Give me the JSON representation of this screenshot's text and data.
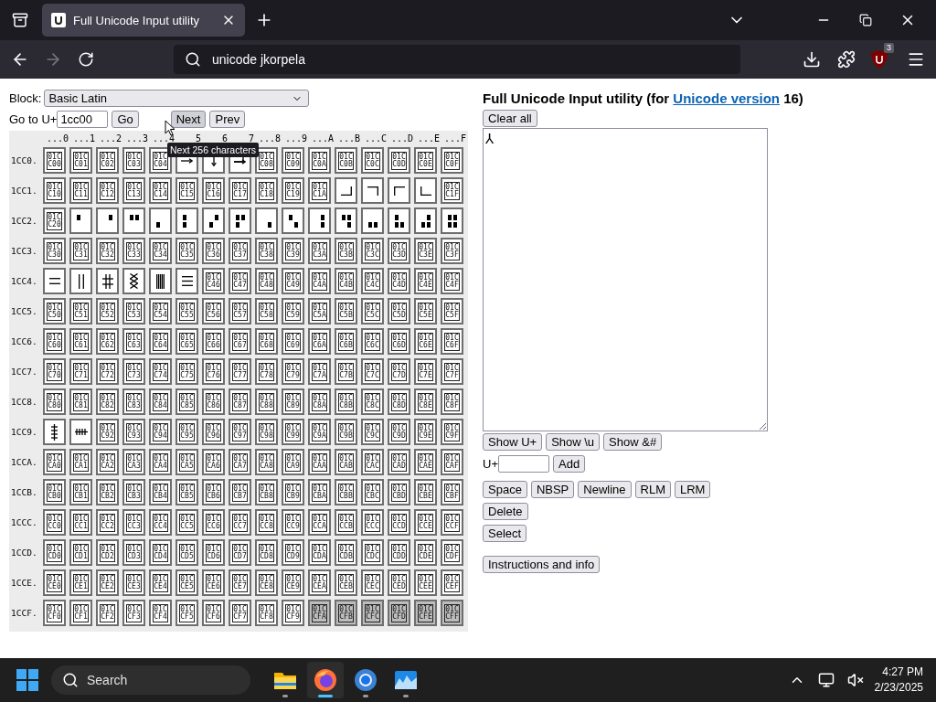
{
  "browser": {
    "tabs": [
      {
        "title": "Full Unicode Input utility",
        "selected": true
      }
    ],
    "back_disabled": false,
    "forward_disabled": true,
    "address": "unicode jkorpela",
    "extension_badge": "3"
  },
  "chooser": {
    "block_label": "Block:",
    "block_value": "Basic Latin",
    "goto_label": "Go to U+",
    "goto_value": "1cc00",
    "buttons": [
      {
        "label": "Go",
        "hovered": false
      },
      {
        "label": "Next",
        "hovered": true
      },
      {
        "label": "Prev",
        "hovered": false
      }
    ],
    "tooltip": "Next 256 characters",
    "columns": [
      "...0",
      "...1",
      "...2",
      "...3",
      "...4",
      "5",
      "6",
      "7",
      "...8",
      "...9",
      "...A",
      "...B",
      "...C",
      "...D",
      "...E",
      "...F"
    ],
    "rows": [
      {
        "label": "1CC0.",
        "cells": [
          {
            "kind": "missing",
            "glyph": "01CC00",
            "disabled": false
          },
          {
            "kind": "missing",
            "glyph": "01CC01",
            "disabled": false
          },
          {
            "kind": "missing",
            "glyph": "01CC02",
            "disabled": false
          },
          {
            "kind": "missing",
            "glyph": "01CC03",
            "disabled": false
          },
          {
            "kind": "missing",
            "glyph": "01CC04",
            "disabled": false
          },
          {
            "kind": "rightarrow",
            "disabled": false
          },
          {
            "kind": "downarrow",
            "disabled": false
          },
          {
            "kind": "hookarrow",
            "disabled": false
          },
          {
            "kind": "missing",
            "glyph": "01CC08",
            "disabled": false
          },
          {
            "kind": "missing",
            "glyph": "01CC09",
            "disabled": false
          },
          {
            "kind": "missing",
            "glyph": "01CC0A",
            "disabled": false
          },
          {
            "kind": "missing",
            "glyph": "01CC0B",
            "disabled": false
          },
          {
            "kind": "missing",
            "glyph": "01CC0C",
            "disabled": false
          },
          {
            "kind": "missing",
            "glyph": "01CC0D",
            "disabled": false
          },
          {
            "kind": "missing",
            "glyph": "01CC0E",
            "disabled": false
          },
          {
            "kind": "missing",
            "glyph": "01CC0F",
            "disabled": false
          }
        ]
      },
      {
        "label": "1CC1.",
        "cells": [
          {
            "kind": "missing",
            "glyph": "01CC10",
            "disabled": false
          },
          {
            "kind": "missing",
            "glyph": "01CC11",
            "disabled": false
          },
          {
            "kind": "missing",
            "glyph": "01CC12",
            "disabled": false
          },
          {
            "kind": "missing",
            "glyph": "01CC13",
            "disabled": false
          },
          {
            "kind": "missing",
            "glyph": "01CC14",
            "disabled": false
          },
          {
            "kind": "missing",
            "glyph": "01CC15",
            "disabled": false
          },
          {
            "kind": "missing",
            "glyph": "01CC16",
            "disabled": false
          },
          {
            "kind": "missing",
            "glyph": "01CC17",
            "disabled": false
          },
          {
            "kind": "missing",
            "glyph": "01CC18",
            "disabled": false
          },
          {
            "kind": "missing",
            "glyph": "01CC19",
            "disabled": false
          },
          {
            "kind": "missing",
            "glyph": "01CC1A",
            "disabled": false
          },
          {
            "kind": "cornerbr",
            "disabled": false
          },
          {
            "kind": "cornertr",
            "disabled": false
          },
          {
            "kind": "cornertl",
            "disabled": false
          },
          {
            "kind": "cornerbl",
            "disabled": false
          },
          {
            "kind": "missing",
            "glyph": "01CC1F",
            "disabled": false
          }
        ]
      },
      {
        "label": "1CC2.",
        "cells": [
          {
            "kind": "missing",
            "glyph": "01CC20",
            "disabled": false
          },
          {
            "kind": "quad1000",
            "disabled": false
          },
          {
            "kind": "quad0100",
            "disabled": false
          },
          {
            "kind": "quad1100",
            "disabled": false
          },
          {
            "kind": "quad0010",
            "disabled": false
          },
          {
            "kind": "quad1010",
            "disabled": false
          },
          {
            "kind": "quad0110",
            "disabled": false
          },
          {
            "kind": "quad1110",
            "disabled": false
          },
          {
            "kind": "quad0001",
            "disabled": false
          },
          {
            "kind": "quad1001",
            "disabled": false
          },
          {
            "kind": "quad0101",
            "disabled": false
          },
          {
            "kind": "quad1101",
            "disabled": false
          },
          {
            "kind": "quad0011",
            "disabled": false
          },
          {
            "kind": "quad1011",
            "disabled": false
          },
          {
            "kind": "quad0111",
            "disabled": false
          },
          {
            "kind": "quad1111",
            "disabled": false
          }
        ]
      },
      {
        "label": "1CC3.",
        "cells": [
          {
            "kind": "missing",
            "glyph": "01CC30",
            "disabled": false
          },
          {
            "kind": "missing",
            "glyph": "01CC31",
            "disabled": false
          },
          {
            "kind": "missing",
            "glyph": "01CC32",
            "disabled": false
          },
          {
            "kind": "missing",
            "glyph": "01CC33",
            "disabled": false
          },
          {
            "kind": "missing",
            "glyph": "01CC34",
            "disabled": false
          },
          {
            "kind": "missing",
            "glyph": "01CC35",
            "disabled": false
          },
          {
            "kind": "missing",
            "glyph": "01CC36",
            "disabled": false
          },
          {
            "kind": "missing",
            "glyph": "01CC37",
            "disabled": false
          },
          {
            "kind": "missing",
            "glyph": "01CC38",
            "disabled": false
          },
          {
            "kind": "missing",
            "glyph": "01CC39",
            "disabled": false
          },
          {
            "kind": "missing",
            "glyph": "01CC3A",
            "disabled": false
          },
          {
            "kind": "missing",
            "glyph": "01CC3B",
            "disabled": false
          },
          {
            "kind": "missing",
            "glyph": "01CC3C",
            "disabled": false
          },
          {
            "kind": "missing",
            "glyph": "01CC3D",
            "disabled": false
          },
          {
            "kind": "missing",
            "glyph": "01CC3E",
            "disabled": false
          },
          {
            "kind": "missing",
            "glyph": "01CC3F",
            "disabled": false
          }
        ]
      },
      {
        "label": "1CC4.",
        "cells": [
          {
            "kind": "doubleline",
            "disabled": false
          },
          {
            "kind": "doublebar",
            "disabled": false
          },
          {
            "kind": "hash",
            "disabled": false
          },
          {
            "kind": "lattice",
            "disabled": false
          },
          {
            "kind": "bars",
            "disabled": false
          },
          {
            "kind": "tripleline",
            "disabled": false
          },
          {
            "kind": "missing",
            "glyph": "01CC46",
            "disabled": false
          },
          {
            "kind": "missing",
            "glyph": "01CC47",
            "disabled": false
          },
          {
            "kind": "missing",
            "glyph": "01CC48",
            "disabled": false
          },
          {
            "kind": "missing",
            "glyph": "01CC49",
            "disabled": false
          },
          {
            "kind": "missing",
            "glyph": "01CC4A",
            "disabled": false
          },
          {
            "kind": "missing",
            "glyph": "01CC4B",
            "disabled": false
          },
          {
            "kind": "missing",
            "glyph": "01CC4C",
            "disabled": false
          },
          {
            "kind": "missing",
            "glyph": "01CC4D",
            "disabled": false
          },
          {
            "kind": "missing",
            "glyph": "01CC4E",
            "disabled": false
          },
          {
            "kind": "missing",
            "glyph": "01CC4F",
            "disabled": false
          }
        ]
      },
      {
        "label": "1CC5.",
        "cells": [
          {
            "kind": "missing",
            "glyph": "01CC50",
            "disabled": false
          },
          {
            "kind": "missing",
            "glyph": "01CC51",
            "disabled": false
          },
          {
            "kind": "missing",
            "glyph": "01CC52",
            "disabled": false
          },
          {
            "kind": "missing",
            "glyph": "01CC53",
            "disabled": false
          },
          {
            "kind": "missing",
            "glyph": "01CC54",
            "disabled": false
          },
          {
            "kind": "missing",
            "glyph": "01CC55",
            "disabled": false
          },
          {
            "kind": "missing",
            "glyph": "01CC56",
            "disabled": false
          },
          {
            "kind": "missing",
            "glyph": "01CC57",
            "disabled": false
          },
          {
            "kind": "missing",
            "glyph": "01CC58",
            "disabled": false
          },
          {
            "kind": "missing",
            "glyph": "01CC59",
            "disabled": false
          },
          {
            "kind": "missing",
            "glyph": "01CC5A",
            "disabled": false
          },
          {
            "kind": "missing",
            "glyph": "01CC5B",
            "disabled": false
          },
          {
            "kind": "missing",
            "glyph": "01CC5C",
            "disabled": false
          },
          {
            "kind": "missing",
            "glyph": "01CC5D",
            "disabled": false
          },
          {
            "kind": "missing",
            "glyph": "01CC5E",
            "disabled": false
          },
          {
            "kind": "missing",
            "glyph": "01CC5F",
            "disabled": false
          }
        ]
      },
      {
        "label": "1CC6.",
        "cells": [
          {
            "kind": "missing",
            "glyph": "01CC60",
            "disabled": false
          },
          {
            "kind": "missing",
            "glyph": "01CC61",
            "disabled": false
          },
          {
            "kind": "missing",
            "glyph": "01CC62",
            "disabled": false
          },
          {
            "kind": "missing",
            "glyph": "01CC63",
            "disabled": false
          },
          {
            "kind": "missing",
            "glyph": "01CC64",
            "disabled": false
          },
          {
            "kind": "missing",
            "glyph": "01CC65",
            "disabled": false
          },
          {
            "kind": "missing",
            "glyph": "01CC66",
            "disabled": false
          },
          {
            "kind": "missing",
            "glyph": "01CC67",
            "disabled": false
          },
          {
            "kind": "missing",
            "glyph": "01CC68",
            "disabled": false
          },
          {
            "kind": "missing",
            "glyph": "01CC69",
            "disabled": false
          },
          {
            "kind": "missing",
            "glyph": "01CC6A",
            "disabled": false
          },
          {
            "kind": "missing",
            "glyph": "01CC6B",
            "disabled": false
          },
          {
            "kind": "missing",
            "glyph": "01CC6C",
            "disabled": false
          },
          {
            "kind": "missing",
            "glyph": "01CC6D",
            "disabled": false
          },
          {
            "kind": "missing",
            "glyph": "01CC6E",
            "disabled": false
          },
          {
            "kind": "missing",
            "glyph": "01CC6F",
            "disabled": false
          }
        ]
      },
      {
        "label": "1CC7.",
        "cells": [
          {
            "kind": "missing",
            "glyph": "01CC70",
            "disabled": false
          },
          {
            "kind": "missing",
            "glyph": "01CC71",
            "disabled": false
          },
          {
            "kind": "missing",
            "glyph": "01CC72",
            "disabled": false
          },
          {
            "kind": "missing",
            "glyph": "01CC73",
            "disabled": false
          },
          {
            "kind": "missing",
            "glyph": "01CC74",
            "disabled": false
          },
          {
            "kind": "missing",
            "glyph": "01CC75",
            "disabled": false
          },
          {
            "kind": "missing",
            "glyph": "01CC76",
            "disabled": false
          },
          {
            "kind": "missing",
            "glyph": "01CC77",
            "disabled": false
          },
          {
            "kind": "missing",
            "glyph": "01CC78",
            "disabled": false
          },
          {
            "kind": "missing",
            "glyph": "01CC79",
            "disabled": false
          },
          {
            "kind": "missing",
            "glyph": "01CC7A",
            "disabled": false
          },
          {
            "kind": "missing",
            "glyph": "01CC7B",
            "disabled": false
          },
          {
            "kind": "missing",
            "glyph": "01CC7C",
            "disabled": false
          },
          {
            "kind": "missing",
            "glyph": "01CC7D",
            "disabled": false
          },
          {
            "kind": "missing",
            "glyph": "01CC7E",
            "disabled": false
          },
          {
            "kind": "missing",
            "glyph": "01CC7F",
            "disabled": false
          }
        ]
      },
      {
        "label": "1CC8.",
        "cells": [
          {
            "kind": "missing",
            "glyph": "01CC80",
            "disabled": false
          },
          {
            "kind": "missing",
            "glyph": "01CC81",
            "disabled": false
          },
          {
            "kind": "missing",
            "glyph": "01CC82",
            "disabled": false
          },
          {
            "kind": "missing",
            "glyph": "01CC83",
            "disabled": false
          },
          {
            "kind": "missing",
            "glyph": "01CC84",
            "disabled": false
          },
          {
            "kind": "missing",
            "glyph": "01CC85",
            "disabled": false
          },
          {
            "kind": "missing",
            "glyph": "01CC86",
            "disabled": false
          },
          {
            "kind": "missing",
            "glyph": "01CC87",
            "disabled": false
          },
          {
            "kind": "missing",
            "glyph": "01CC88",
            "disabled": false
          },
          {
            "kind": "missing",
            "glyph": "01CC89",
            "disabled": false
          },
          {
            "kind": "missing",
            "glyph": "01CC8A",
            "disabled": false
          },
          {
            "kind": "missing",
            "glyph": "01CC8B",
            "disabled": false
          },
          {
            "kind": "missing",
            "glyph": "01CC8C",
            "disabled": false
          },
          {
            "kind": "missing",
            "glyph": "01CC8D",
            "disabled": false
          },
          {
            "kind": "missing",
            "glyph": "01CC8E",
            "disabled": false
          },
          {
            "kind": "missing",
            "glyph": "01CC8F",
            "disabled": false
          }
        ]
      },
      {
        "label": "1CC9.",
        "cells": [
          {
            "kind": "vticks",
            "disabled": false
          },
          {
            "kind": "hticks",
            "disabled": false
          },
          {
            "kind": "missing",
            "glyph": "01CC92",
            "disabled": false
          },
          {
            "kind": "missing",
            "glyph": "01CC93",
            "disabled": false
          },
          {
            "kind": "missing",
            "glyph": "01CC94",
            "disabled": false
          },
          {
            "kind": "missing",
            "glyph": "01CC95",
            "disabled": false
          },
          {
            "kind": "missing",
            "glyph": "01CC96",
            "disabled": false
          },
          {
            "kind": "missing",
            "glyph": "01CC97",
            "disabled": false
          },
          {
            "kind": "missing",
            "glyph": "01CC98",
            "disabled": false
          },
          {
            "kind": "missing",
            "glyph": "01CC99",
            "disabled": false
          },
          {
            "kind": "missing",
            "glyph": "01CC9A",
            "disabled": false
          },
          {
            "kind": "missing",
            "glyph": "01CC9B",
            "disabled": false
          },
          {
            "kind": "missing",
            "glyph": "01CC9C",
            "disabled": false
          },
          {
            "kind": "missing",
            "glyph": "01CC9D",
            "disabled": false
          },
          {
            "kind": "missing",
            "glyph": "01CC9E",
            "disabled": false
          },
          {
            "kind": "missing",
            "glyph": "01CC9F",
            "disabled": false
          }
        ]
      },
      {
        "label": "1CCA.",
        "cells": [
          {
            "kind": "missing",
            "glyph": "01CCA0",
            "disabled": false
          },
          {
            "kind": "missing",
            "glyph": "01CCA1",
            "disabled": false
          },
          {
            "kind": "missing",
            "glyph": "01CCA2",
            "disabled": false
          },
          {
            "kind": "missing",
            "glyph": "01CCA3",
            "disabled": false
          },
          {
            "kind": "missing",
            "glyph": "01CCA4",
            "disabled": false
          },
          {
            "kind": "missing",
            "glyph": "01CCA5",
            "disabled": false
          },
          {
            "kind": "missing",
            "glyph": "01CCA6",
            "disabled": false
          },
          {
            "kind": "missing",
            "glyph": "01CCA7",
            "disabled": false
          },
          {
            "kind": "missing",
            "glyph": "01CCA8",
            "disabled": false
          },
          {
            "kind": "missing",
            "glyph": "01CCA9",
            "disabled": false
          },
          {
            "kind": "missing",
            "glyph": "01CCAA",
            "disabled": false
          },
          {
            "kind": "missing",
            "glyph": "01CCAB",
            "disabled": false
          },
          {
            "kind": "missing",
            "glyph": "01CCAC",
            "disabled": false
          },
          {
            "kind": "missing",
            "glyph": "01CCAD",
            "disabled": false
          },
          {
            "kind": "missing",
            "glyph": "01CCAE",
            "disabled": false
          },
          {
            "kind": "missing",
            "glyph": "01CCAF",
            "disabled": false
          }
        ]
      },
      {
        "label": "1CCB.",
        "cells": [
          {
            "kind": "missing",
            "glyph": "01CCB0",
            "disabled": false
          },
          {
            "kind": "missing",
            "glyph": "01CCB1",
            "disabled": false
          },
          {
            "kind": "missing",
            "glyph": "01CCB2",
            "disabled": false
          },
          {
            "kind": "missing",
            "glyph": "01CCB3",
            "disabled": false
          },
          {
            "kind": "missing",
            "glyph": "01CCB4",
            "disabled": false
          },
          {
            "kind": "missing",
            "glyph": "01CCB5",
            "disabled": false
          },
          {
            "kind": "missing",
            "glyph": "01CCB6",
            "disabled": false
          },
          {
            "kind": "missing",
            "glyph": "01CCB7",
            "disabled": false
          },
          {
            "kind": "missing",
            "glyph": "01CCB8",
            "disabled": false
          },
          {
            "kind": "missing",
            "glyph": "01CCB9",
            "disabled": false
          },
          {
            "kind": "missing",
            "glyph": "01CCBA",
            "disabled": false
          },
          {
            "kind": "missing",
            "glyph": "01CCBB",
            "disabled": false
          },
          {
            "kind": "missing",
            "glyph": "01CCBC",
            "disabled": false
          },
          {
            "kind": "missing",
            "glyph": "01CCBD",
            "disabled": false
          },
          {
            "kind": "missing",
            "glyph": "01CCBE",
            "disabled": false
          },
          {
            "kind": "missing",
            "glyph": "01CCBF",
            "disabled": false
          }
        ]
      },
      {
        "label": "1CCC.",
        "cells": [
          {
            "kind": "missing",
            "glyph": "01CCC0",
            "disabled": false
          },
          {
            "kind": "missing",
            "glyph": "01CCC1",
            "disabled": false
          },
          {
            "kind": "missing",
            "glyph": "01CCC2",
            "disabled": false
          },
          {
            "kind": "missing",
            "glyph": "01CCC3",
            "disabled": false
          },
          {
            "kind": "missing",
            "glyph": "01CCC4",
            "disabled": false
          },
          {
            "kind": "missing",
            "glyph": "01CCC5",
            "disabled": false
          },
          {
            "kind": "missing",
            "glyph": "01CCC6",
            "disabled": false
          },
          {
            "kind": "missing",
            "glyph": "01CCC7",
            "disabled": false
          },
          {
            "kind": "missing",
            "glyph": "01CCC8",
            "disabled": false
          },
          {
            "kind": "missing",
            "glyph": "01CCC9",
            "disabled": false
          },
          {
            "kind": "missing",
            "glyph": "01CCCA",
            "disabled": false
          },
          {
            "kind": "missing",
            "glyph": "01CCCB",
            "disabled": false
          },
          {
            "kind": "missing",
            "glyph": "01CCCC",
            "disabled": false
          },
          {
            "kind": "missing",
            "glyph": "01CCCD",
            "disabled": false
          },
          {
            "kind": "missing",
            "glyph": "01CCCE",
            "disabled": false
          },
          {
            "kind": "missing",
            "glyph": "01CCCF",
            "disabled": false
          }
        ]
      },
      {
        "label": "1CCD.",
        "cells": [
          {
            "kind": "missing",
            "glyph": "01CCD0",
            "disabled": false
          },
          {
            "kind": "missing",
            "glyph": "01CCD1",
            "disabled": false
          },
          {
            "kind": "missing",
            "glyph": "01CCD2",
            "disabled": false
          },
          {
            "kind": "missing",
            "glyph": "01CCD3",
            "disabled": false
          },
          {
            "kind": "missing",
            "glyph": "01CCD4",
            "disabled": false
          },
          {
            "kind": "missing",
            "glyph": "01CCD5",
            "disabled": false
          },
          {
            "kind": "missing",
            "glyph": "01CCD6",
            "disabled": false
          },
          {
            "kind": "missing",
            "glyph": "01CCD7",
            "disabled": false
          },
          {
            "kind": "missing",
            "glyph": "01CCD8",
            "disabled": false
          },
          {
            "kind": "missing",
            "glyph": "01CCD9",
            "disabled": false
          },
          {
            "kind": "missing",
            "glyph": "01CCDA",
            "disabled": false
          },
          {
            "kind": "missing",
            "glyph": "01CCDB",
            "disabled": false
          },
          {
            "kind": "missing",
            "glyph": "01CCDC",
            "disabled": false
          },
          {
            "kind": "missing",
            "glyph": "01CCDD",
            "disabled": false
          },
          {
            "kind": "missing",
            "glyph": "01CCDE",
            "disabled": false
          },
          {
            "kind": "missing",
            "glyph": "01CCDF",
            "disabled": false
          }
        ]
      },
      {
        "label": "1CCE.",
        "cells": [
          {
            "kind": "missing",
            "glyph": "01CCE0",
            "disabled": false
          },
          {
            "kind": "missing",
            "glyph": "01CCE1",
            "disabled": false
          },
          {
            "kind": "missing",
            "glyph": "01CCE2",
            "disabled": false
          },
          {
            "kind": "missing",
            "glyph": "01CCE3",
            "disabled": false
          },
          {
            "kind": "missing",
            "glyph": "01CCE4",
            "disabled": false
          },
          {
            "kind": "missing",
            "glyph": "01CCE5",
            "disabled": false
          },
          {
            "kind": "missing",
            "glyph": "01CCE6",
            "disabled": false
          },
          {
            "kind": "missing",
            "glyph": "01CCE7",
            "disabled": false
          },
          {
            "kind": "missing",
            "glyph": "01CCE8",
            "disabled": false
          },
          {
            "kind": "missing",
            "glyph": "01CCE9",
            "disabled": false
          },
          {
            "kind": "missing",
            "glyph": "01CCEA",
            "disabled": false
          },
          {
            "kind": "missing",
            "glyph": "01CCEB",
            "disabled": false
          },
          {
            "kind": "missing",
            "glyph": "01CCEC",
            "disabled": false
          },
          {
            "kind": "missing",
            "glyph": "01CCED",
            "disabled": false
          },
          {
            "kind": "missing",
            "glyph": "01CCEE",
            "disabled": false
          },
          {
            "kind": "missing",
            "glyph": "01CCEF",
            "disabled": false
          }
        ]
      },
      {
        "label": "1CCF.",
        "cells": [
          {
            "kind": "missing",
            "glyph": "01CCF0",
            "disabled": false
          },
          {
            "kind": "missing",
            "glyph": "01CCF1",
            "disabled": false
          },
          {
            "kind": "missing",
            "glyph": "01CCF2",
            "disabled": false
          },
          {
            "kind": "missing",
            "glyph": "01CCF3",
            "disabled": false
          },
          {
            "kind": "missing",
            "glyph": "01CCF4",
            "disabled": false
          },
          {
            "kind": "missing",
            "glyph": "01CCF5",
            "disabled": false
          },
          {
            "kind": "missing",
            "glyph": "01CCF6",
            "disabled": false
          },
          {
            "kind": "missing",
            "glyph": "01CCF7",
            "disabled": false
          },
          {
            "kind": "missing",
            "glyph": "01CCF8",
            "disabled": false
          },
          {
            "kind": "missing",
            "glyph": "01CCF9",
            "disabled": false
          },
          {
            "kind": "missing",
            "glyph": "01CCFA",
            "disabled": true
          },
          {
            "kind": "missing",
            "glyph": "01CCFB",
            "disabled": true
          },
          {
            "kind": "missing",
            "glyph": "01CCFC",
            "disabled": true
          },
          {
            "kind": "missing",
            "glyph": "01CCFD",
            "disabled": true
          },
          {
            "kind": "missing",
            "glyph": "01CCFE",
            "disabled": true
          },
          {
            "kind": "missing",
            "glyph": "01CCFF",
            "disabled": true
          }
        ]
      }
    ]
  },
  "editor": {
    "title_prefix": "Full Unicode Input utility (for ",
    "title_link": "Unicode version",
    "title_suffix": " 16)",
    "clear_button": "Clear all",
    "text": "⅄",
    "show_buttons": [
      "Show U+",
      "Show \\u",
      "Show &#"
    ],
    "code_label": "U+",
    "add_button": "Add",
    "insert_buttons": [
      "Space",
      "NBSP",
      "Newline",
      "RLM",
      "LRM"
    ],
    "delete_button": "Delete",
    "select_button": "Select",
    "info_button": "Instructions and info"
  },
  "taskbar": {
    "search_placeholder": "Search",
    "apps": [
      {
        "kind": "files",
        "active": false
      },
      {
        "kind": "firefox",
        "active": true
      },
      {
        "kind": "chrome",
        "active": false
      },
      {
        "kind": "photos",
        "active": false
      }
    ],
    "time": "4:27 PM",
    "date": "2/23/2025"
  }
}
